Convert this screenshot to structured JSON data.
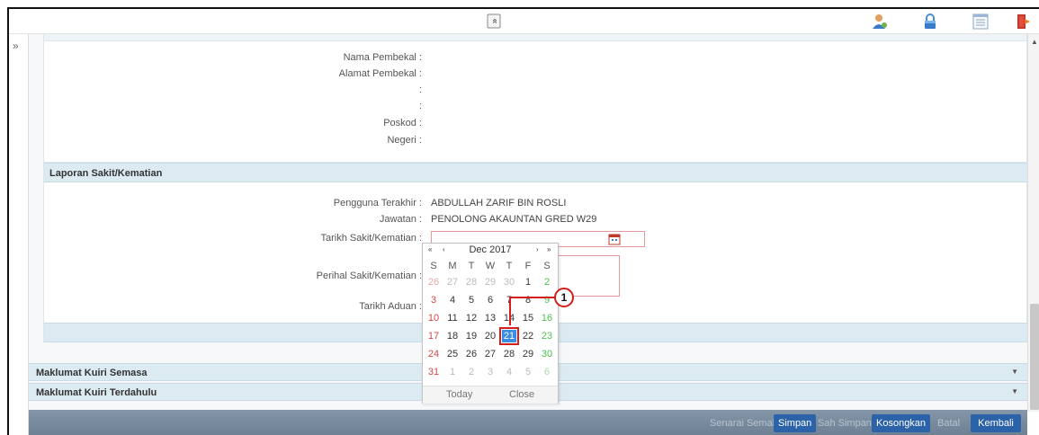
{
  "topbar": {
    "collapse_glyph": "«",
    "icons": [
      "user-icon",
      "lock-icon",
      "list-icon",
      "logout-icon"
    ]
  },
  "leftstrip": {
    "expand_glyph": "»"
  },
  "supplier": {
    "fields": [
      {
        "label": "Nama Pembekal :",
        "value": ""
      },
      {
        "label": "Alamat Pembekal :",
        "value": ""
      },
      {
        "label": ":",
        "value": ""
      },
      {
        "label": ":",
        "value": ""
      },
      {
        "label": "Poskod :",
        "value": ""
      },
      {
        "label": "Negeri :",
        "value": ""
      }
    ]
  },
  "laporan": {
    "title": "Laporan Sakit/Kematian",
    "pengguna_label": "Pengguna Terakhir :",
    "pengguna_value": "ABDULLAH ZARIF BIN ROSLI",
    "jawatan_label": "Jawatan :",
    "jawatan_value": "PENOLONG AKAUNTAN GRED W29",
    "tarikh_label": "Tarikh Sakit/Kematian :",
    "tarikh_value": "",
    "perihal_label": "Perihal Sakit/Kematian :",
    "perihal_value": "",
    "aduan_label": "Tarikh Aduan :"
  },
  "sections": {
    "semasa": "Maklumat Kuiri Semasa",
    "terdahulu": "Maklumat Kuiri Terdahulu"
  },
  "toolbar": {
    "senarai_semak": "Senarai Semak",
    "simpan": "Simpan",
    "sah_simpan": "Sah Simpan",
    "kosongkan": "Kosongkan",
    "batal": "Batal",
    "kembali": "Kembali"
  },
  "calendar": {
    "prev_year": "«",
    "prev_month": "‹",
    "title": "Dec 2017",
    "next_month": "›",
    "next_year": "»",
    "days_of_week": [
      "S",
      "M",
      "T",
      "W",
      "T",
      "F",
      "S"
    ],
    "weeks": [
      [
        "26",
        "27",
        "28",
        "29",
        "30",
        "1",
        "2"
      ],
      [
        "3",
        "4",
        "5",
        "6",
        "7",
        "8",
        "9"
      ],
      [
        "10",
        "11",
        "12",
        "13",
        "14",
        "15",
        "16"
      ],
      [
        "17",
        "18",
        "19",
        "20",
        "21",
        "22",
        "23"
      ],
      [
        "24",
        "25",
        "26",
        "27",
        "28",
        "29",
        "30"
      ],
      [
        "31",
        "1",
        "2",
        "3",
        "4",
        "5",
        "6"
      ]
    ],
    "selected": "21",
    "today_label": "Today",
    "close_label": "Close"
  },
  "annotation": {
    "step": "1"
  },
  "colors": {
    "accent": "#2c62a8",
    "header_bg": "#dceaf2",
    "highlight": "#d41d1d",
    "selected_day": "#3a8de0"
  }
}
